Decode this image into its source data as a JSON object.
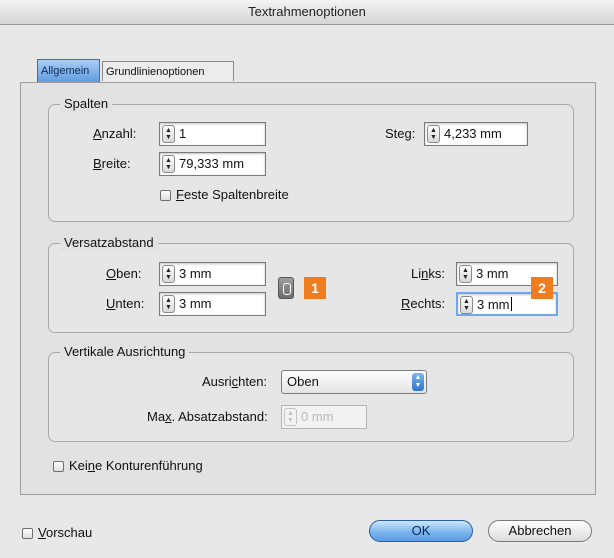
{
  "window": {
    "title": "Textrahmenoptionen"
  },
  "tabs": [
    {
      "label": "Allgemein",
      "active": true
    },
    {
      "label": "Grundlinienoptionen",
      "active": false
    }
  ],
  "spalten": {
    "legend": "Spalten",
    "anzahl": {
      "pre": "",
      "mnemonic": "A",
      "post": "nzahl:",
      "value": "1"
    },
    "breite": {
      "pre": "",
      "mnemonic": "B",
      "post": "reite:",
      "value": "79,333 mm"
    },
    "steg": {
      "pre": "Ste",
      "mnemonic": "g",
      "post": ":",
      "value": "4,233 mm"
    },
    "feste": {
      "pre": "",
      "mnemonic": "F",
      "post": "este Spaltenbreite",
      "checked": false
    }
  },
  "versatz": {
    "legend": "Versatzabstand",
    "oben": {
      "pre": "",
      "mnemonic": "O",
      "post": "ben:",
      "value": "3 mm"
    },
    "unten": {
      "pre": "",
      "mnemonic": "U",
      "post": "nten:",
      "value": "3 mm"
    },
    "links": {
      "pre": "Li",
      "mnemonic": "n",
      "post": "ks:",
      "value": "3 mm"
    },
    "rechts": {
      "pre": "",
      "mnemonic": "R",
      "post": "echts:",
      "value": "3 mm"
    }
  },
  "vertikal": {
    "legend": "Vertikale Ausrichtung",
    "ausrichten": {
      "pre": "Ausri",
      "mnemonic": "c",
      "post": "hten:",
      "value": "Oben"
    },
    "max": {
      "pre": "Ma",
      "mnemonic": "x",
      "post": ". Absatzabstand:",
      "value": "0 mm"
    }
  },
  "kontur": {
    "pre": "Kei",
    "mnemonic": "n",
    "post": "e Konturenführung",
    "checked": false
  },
  "vorschau": {
    "pre": "",
    "mnemonic": "V",
    "post": "orschau",
    "checked": false
  },
  "buttons": {
    "ok": "OK",
    "cancel": "Abbrechen"
  },
  "callouts": {
    "one": "1",
    "two": "2"
  },
  "colors": {
    "callout": "#ef7d1f",
    "default_button": "#5a9ae4",
    "active_tab": "#5d9be0"
  }
}
